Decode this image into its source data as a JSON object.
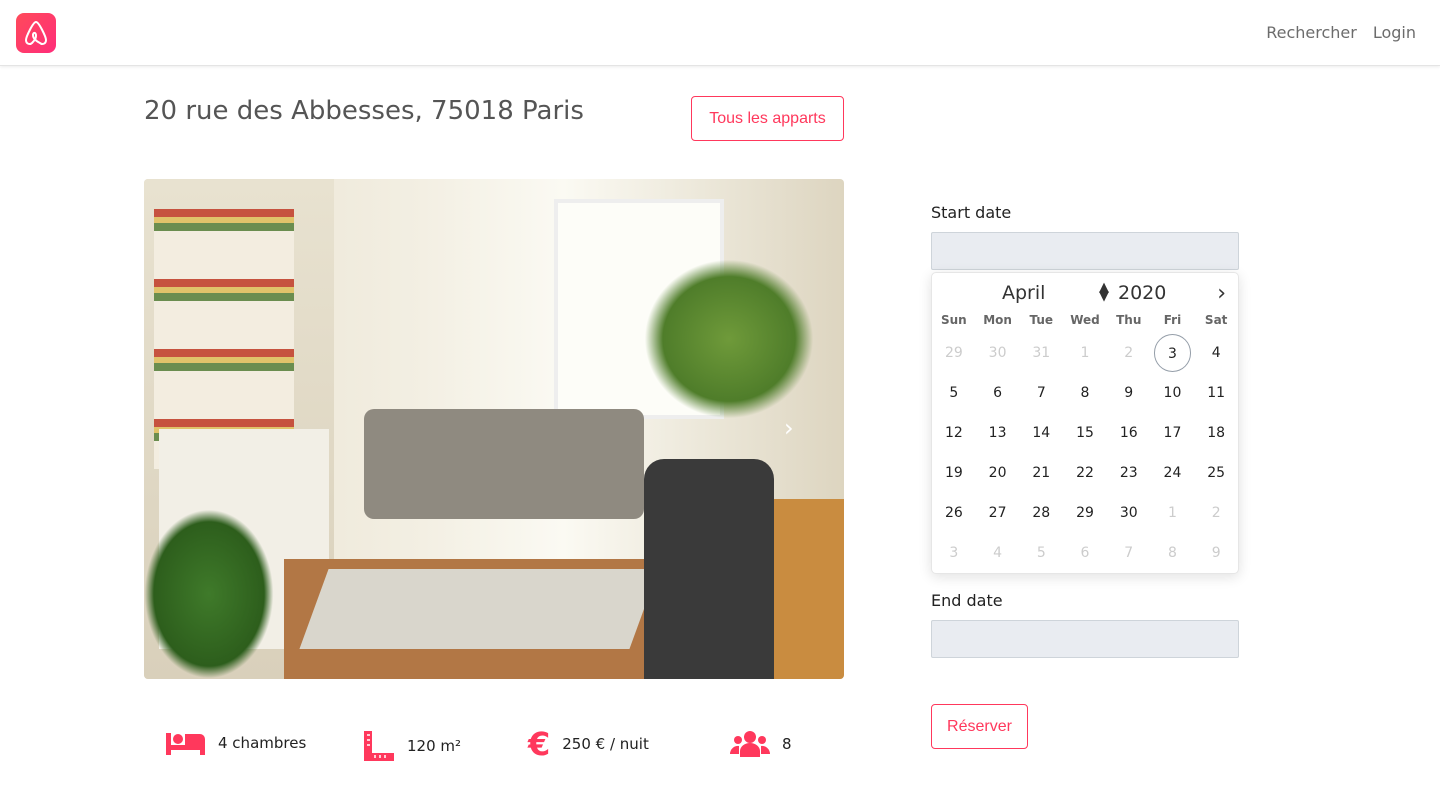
{
  "nav": {
    "links": [
      "Rechercher",
      "Login"
    ]
  },
  "brand_color": "#ff385c",
  "listing": {
    "title": "20 rue des Abbesses, 75018 Paris",
    "all_button": "Tous les apparts",
    "features": [
      {
        "icon": "bed-icon",
        "text": "4 chambres"
      },
      {
        "icon": "ruler-icon",
        "text": "120 m²"
      },
      {
        "icon": "euro-icon",
        "text": "250 € / nuit"
      },
      {
        "icon": "users-icon",
        "text": "8"
      }
    ]
  },
  "booking": {
    "start_label": "Start date",
    "end_label": "End date",
    "start_value": "",
    "end_value": "",
    "reserve_button": "Réserver"
  },
  "calendar": {
    "month": "April",
    "year": "2020",
    "weekdays": [
      "Sun",
      "Mon",
      "Tue",
      "Wed",
      "Thu",
      "Fri",
      "Sat"
    ],
    "weeks": [
      [
        {
          "d": "29",
          "s": "dis"
        },
        {
          "d": "30",
          "s": "dis"
        },
        {
          "d": "31",
          "s": "dis"
        },
        {
          "d": "1",
          "s": "dis"
        },
        {
          "d": "2",
          "s": "dis"
        },
        {
          "d": "3",
          "s": "today"
        },
        {
          "d": "4",
          "s": ""
        }
      ],
      [
        {
          "d": "5",
          "s": ""
        },
        {
          "d": "6",
          "s": ""
        },
        {
          "d": "7",
          "s": ""
        },
        {
          "d": "8",
          "s": ""
        },
        {
          "d": "9",
          "s": ""
        },
        {
          "d": "10",
          "s": ""
        },
        {
          "d": "11",
          "s": ""
        }
      ],
      [
        {
          "d": "12",
          "s": ""
        },
        {
          "d": "13",
          "s": ""
        },
        {
          "d": "14",
          "s": ""
        },
        {
          "d": "15",
          "s": ""
        },
        {
          "d": "16",
          "s": ""
        },
        {
          "d": "17",
          "s": ""
        },
        {
          "d": "18",
          "s": ""
        }
      ],
      [
        {
          "d": "19",
          "s": ""
        },
        {
          "d": "20",
          "s": ""
        },
        {
          "d": "21",
          "s": ""
        },
        {
          "d": "22",
          "s": ""
        },
        {
          "d": "23",
          "s": ""
        },
        {
          "d": "24",
          "s": ""
        },
        {
          "d": "25",
          "s": ""
        }
      ],
      [
        {
          "d": "26",
          "s": ""
        },
        {
          "d": "27",
          "s": ""
        },
        {
          "d": "28",
          "s": ""
        },
        {
          "d": "29",
          "s": ""
        },
        {
          "d": "30",
          "s": ""
        },
        {
          "d": "1",
          "s": "dis"
        },
        {
          "d": "2",
          "s": "dis"
        }
      ],
      [
        {
          "d": "3",
          "s": "dis"
        },
        {
          "d": "4",
          "s": "dis"
        },
        {
          "d": "5",
          "s": "dis"
        },
        {
          "d": "6",
          "s": "dis"
        },
        {
          "d": "7",
          "s": "dis"
        },
        {
          "d": "8",
          "s": "dis"
        },
        {
          "d": "9",
          "s": "dis"
        }
      ]
    ]
  }
}
